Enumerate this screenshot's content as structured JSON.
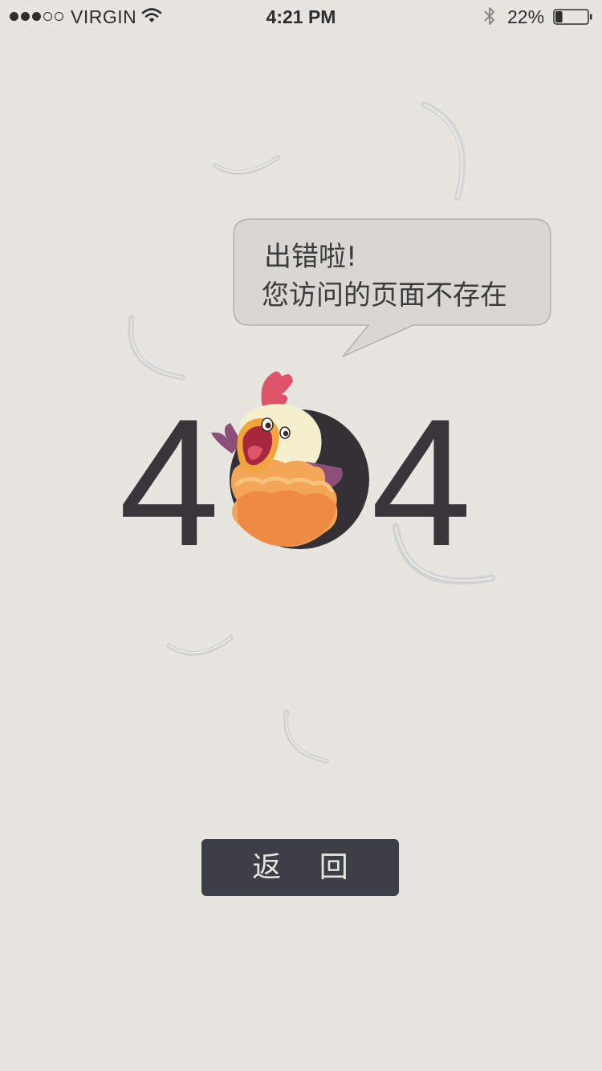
{
  "status_bar": {
    "carrier": "VIRGIN",
    "time": "4:21 PM",
    "battery_percent": "22%",
    "battery_level": 0.22,
    "signal_bars_filled": 3,
    "signal_bars_total": 5,
    "icons": [
      "signal-dots-icon",
      "wifi-icon",
      "bluetooth-icon",
      "battery-icon"
    ]
  },
  "error": {
    "bubble_line1": "出错啦!",
    "bubble_line2": "您访问的页面不存在",
    "digit_first": "4",
    "digit_last": "4"
  },
  "back_button": {
    "label": "返 回"
  },
  "colors": {
    "background": "#e7e5e0",
    "bubble_fill": "#d9d7d1",
    "digit": "#38363a",
    "button_bg": "#3c3f46",
    "button_text": "#e6e4df",
    "chicken_comb": "#e0546a",
    "chicken_body": "#f3a658",
    "chicken_wing": "#8c4f78"
  }
}
